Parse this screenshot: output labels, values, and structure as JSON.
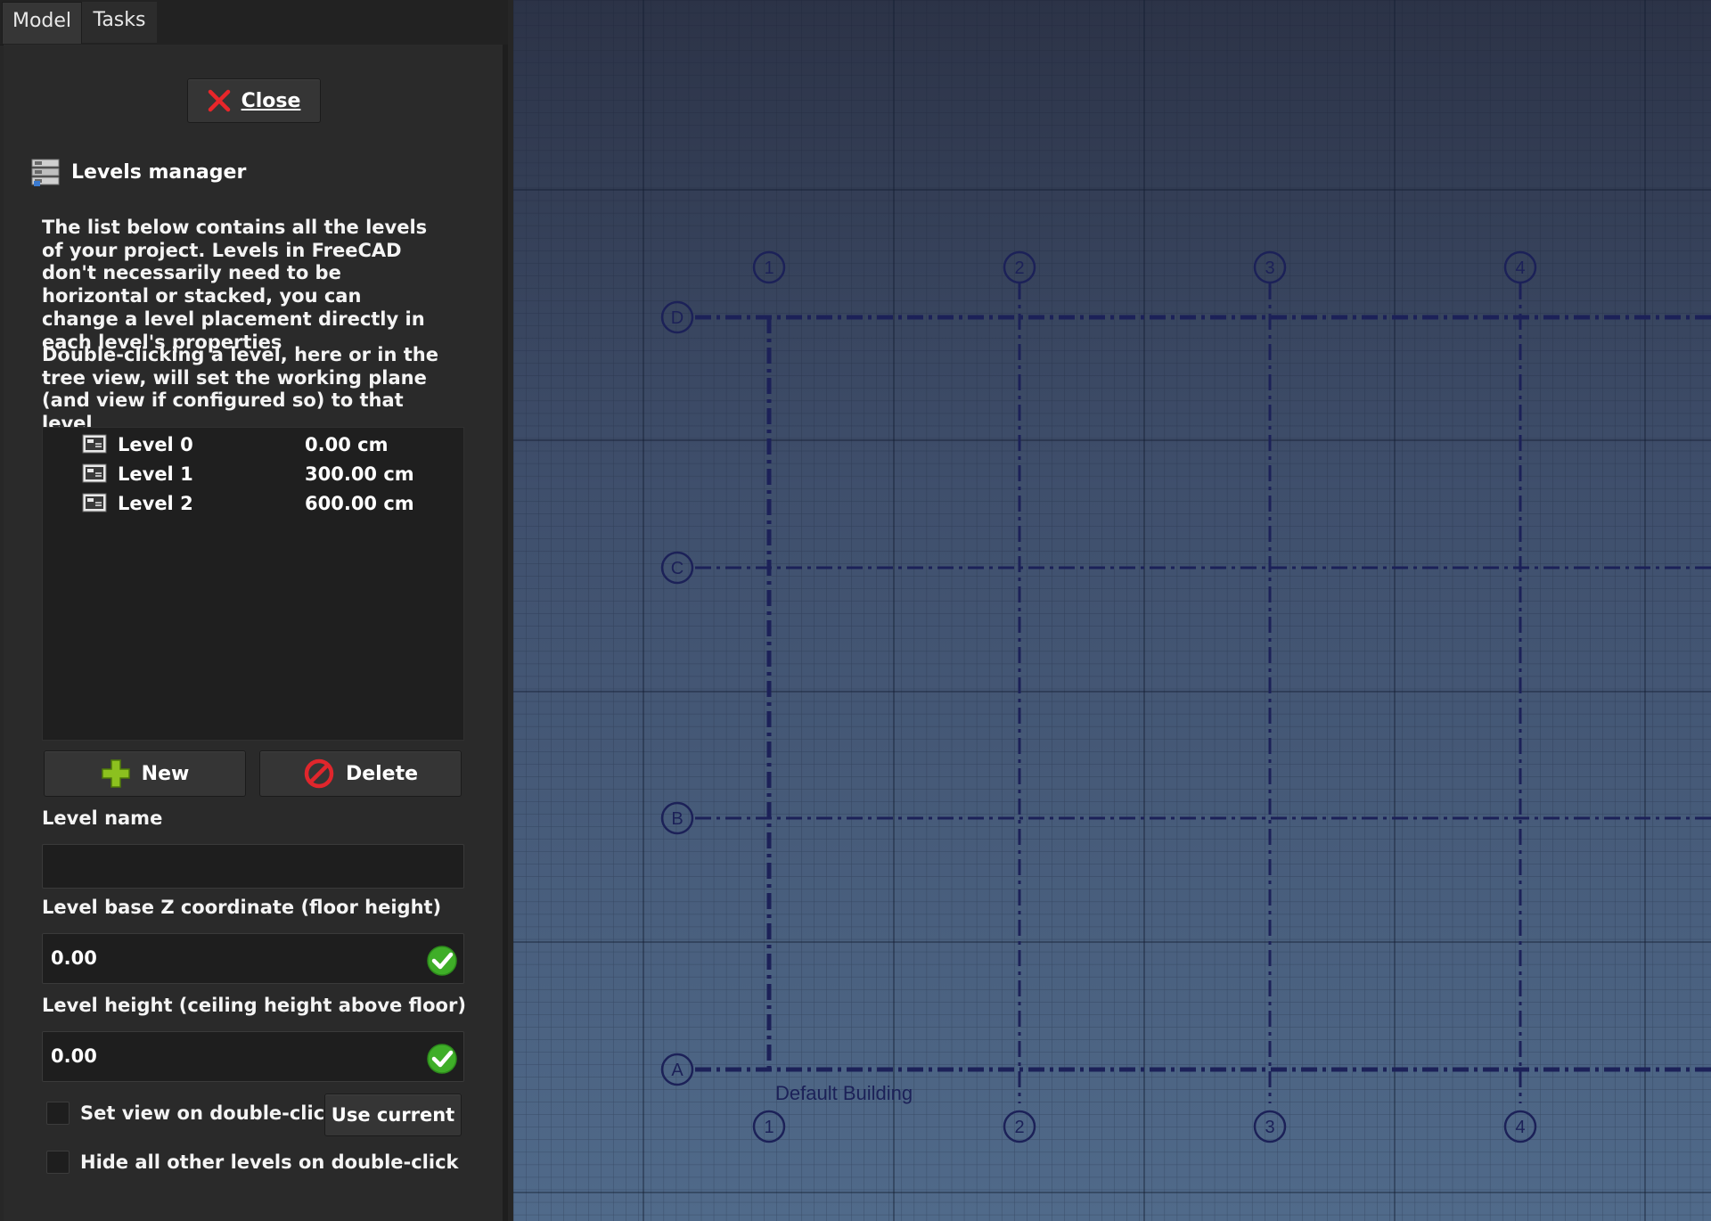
{
  "tabs": [
    {
      "label": "Model"
    },
    {
      "label": "Tasks"
    }
  ],
  "task_panel": {
    "close_label": "Close",
    "title": "Levels manager",
    "description_1": "The list below contains all the levels of your project. Levels in FreeCAD don't necessarily need to be horizontal or stacked, you can change a level placement directly in each level's properties",
    "description_2": "Double-clicking a level, here or in the tree view, will set the working plane (and view if configured so) to that level",
    "levels": [
      {
        "name": "Level 0",
        "height": "0.00 cm"
      },
      {
        "name": "Level 1",
        "height": "300.00 cm"
      },
      {
        "name": "Level 2",
        "height": "600.00 cm"
      }
    ],
    "new_label": "New",
    "delete_label": "Delete",
    "level_name_label": "Level name",
    "level_name_value": "",
    "z_label": "Level base Z coordinate (floor height)",
    "z_value": "0.00",
    "height_label": "Level height (ceiling height above floor)",
    "height_value": "0.00",
    "set_view_label": "Set view on double-click",
    "set_view_checked": false,
    "use_current_label": "Use current",
    "hide_levels_label": "Hide all other levels on double-click",
    "hide_levels_checked": false
  },
  "viewport": {
    "column_labels": [
      "1",
      "2",
      "3",
      "4"
    ],
    "row_labels": [
      "D",
      "C",
      "B",
      "A"
    ],
    "building_label": "Default Building",
    "axis_color": "#1c2158"
  }
}
